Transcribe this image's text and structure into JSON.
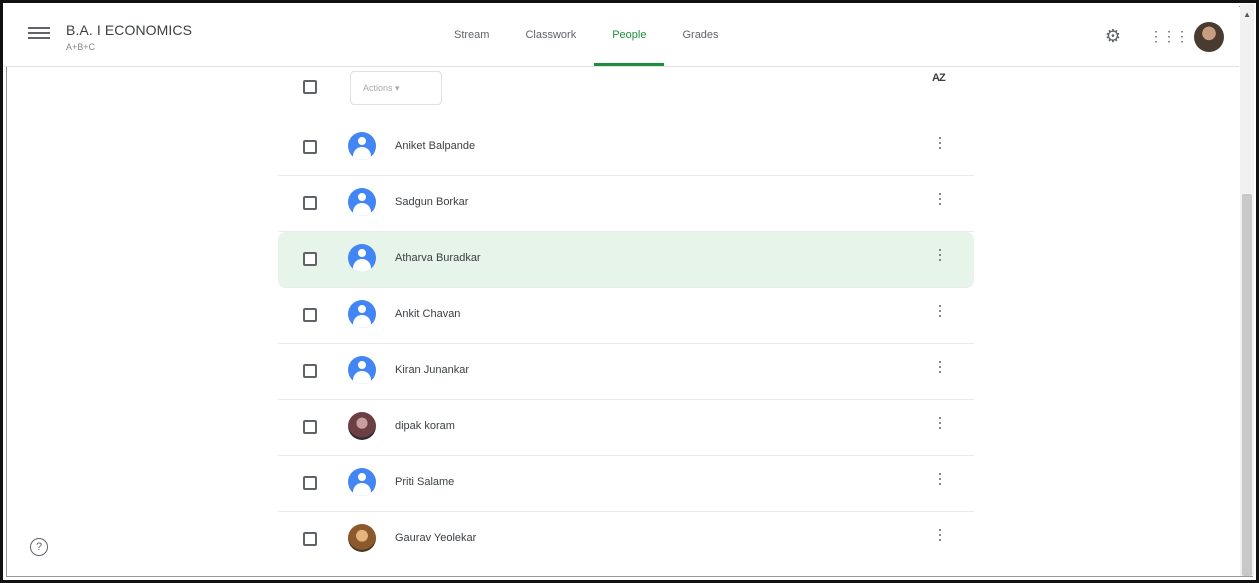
{
  "header": {
    "class_title": "B.A. I ECONOMICS",
    "class_subtitle": "A+B+C",
    "tabs": [
      {
        "label": "Stream"
      },
      {
        "label": "Classwork"
      },
      {
        "label": "People",
        "active": true
      },
      {
        "label": "Grades"
      }
    ]
  },
  "icons": {
    "menu": "hamburger-icon",
    "settings": "gear-icon",
    "apps": "grid-icon",
    "sort": "sort-az-icon",
    "more": "more-vert-icon",
    "help": "help-icon"
  },
  "toolbar": {
    "actions_label": "Actions ▾",
    "sort_label": "AZ"
  },
  "people": [
    {
      "name": "Aniket Balpande",
      "avatar": "default"
    },
    {
      "name": "Sadgun Borkar",
      "avatar": "default"
    },
    {
      "name": "Atharva Buradkar",
      "avatar": "default",
      "highlighted": true
    },
    {
      "name": "Ankit Chavan",
      "avatar": "default"
    },
    {
      "name": "Kiran Junankar",
      "avatar": "default"
    },
    {
      "name": "dipak koram",
      "avatar": "photo"
    },
    {
      "name": "Priti Salame",
      "avatar": "default"
    },
    {
      "name": "Gaurav Yeolekar",
      "avatar": "photo"
    }
  ],
  "colors": {
    "accent": "#1e8e3e",
    "highlight_row": "#e6f4ea",
    "default_avatar": "#4285f4"
  },
  "help": {
    "label": "?"
  }
}
